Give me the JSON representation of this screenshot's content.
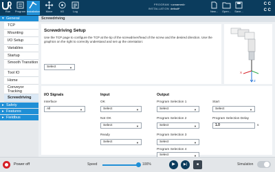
{
  "topbar": {
    "tabs": [
      {
        "label": "Run",
        "icon": "run-icon"
      },
      {
        "label": "Program",
        "icon": "program-icon"
      },
      {
        "label": "Installation",
        "icon": "installation-icon"
      },
      {
        "label": "Move",
        "icon": "move-icon"
      },
      {
        "label": "I/O",
        "icon": "io-icon"
      },
      {
        "label": "Log",
        "icon": "log-icon"
      }
    ],
    "program_key": "PROGRAM",
    "program_value": "<unnamed>",
    "installation_key": "INSTALLATION",
    "installation_value": "default*",
    "file_buttons": [
      {
        "label": "New...",
        "icon": "new-file-icon"
      },
      {
        "label": "Open...",
        "icon": "open-folder-icon"
      },
      {
        "label": "Save...",
        "icon": "save-icon"
      }
    ],
    "cc_top": "C C",
    "cc_bottom": "C C",
    "accent": "#1f8fd6",
    "bar_color": "#0b3c5d"
  },
  "sidebar": {
    "general_label": "General",
    "items": [
      {
        "label": "TCP"
      },
      {
        "label": "Mounting"
      },
      {
        "label": "I/O Setup"
      },
      {
        "label": "Variables"
      },
      {
        "label": "Startup"
      },
      {
        "label": "Smooth Transition"
      },
      {
        "label": "Tool IO"
      },
      {
        "label": "Home"
      },
      {
        "label": "Conveyor Tracking"
      },
      {
        "label": "Screwdriving"
      }
    ],
    "categories": [
      {
        "label": "Safety"
      },
      {
        "label": "Features"
      },
      {
        "label": "Fieldbus"
      }
    ]
  },
  "content": {
    "title": "Screwdriving",
    "setup_heading": "Screwdriving Setup",
    "setup_desc": "Use the TCP page to configure the TCP at the tip of the screwdriver/head of the screw and the desired direction. Use the graphics on the right to correctly understand and set up the orientation:",
    "tcp_select": "Select",
    "io_heading": "I/O Signals",
    "interface_label": "Interface",
    "interface_value": "All",
    "input_heading": "Input",
    "ok_label": "OK",
    "ok_value": "Select",
    "notok_label": "Not OK",
    "notok_value": "Select",
    "ready_label": "Ready",
    "ready_value": "Select",
    "output_heading": "Output",
    "ps1_label": "Program Selection 1",
    "ps1_value": "Select",
    "ps2_label": "Program Selection 2",
    "ps2_value": "Select",
    "ps3_label": "Program Selection 3",
    "ps3_value": "Select",
    "ps4_label": "Program Selection 4",
    "ps4_value": "Select",
    "start_label": "Start",
    "start_value": "Select",
    "delay_label": "Program Selection Delay",
    "delay_value": "1.0",
    "delay_unit": "s",
    "axis_x": "X",
    "axis_z": "Z"
  },
  "bottombar": {
    "power_label": "Power off",
    "speed_label": "Speed",
    "speed_value": "100%",
    "speed_fraction": 1.0,
    "simulation_label": "Simulation",
    "power_color": "#d51f26"
  }
}
